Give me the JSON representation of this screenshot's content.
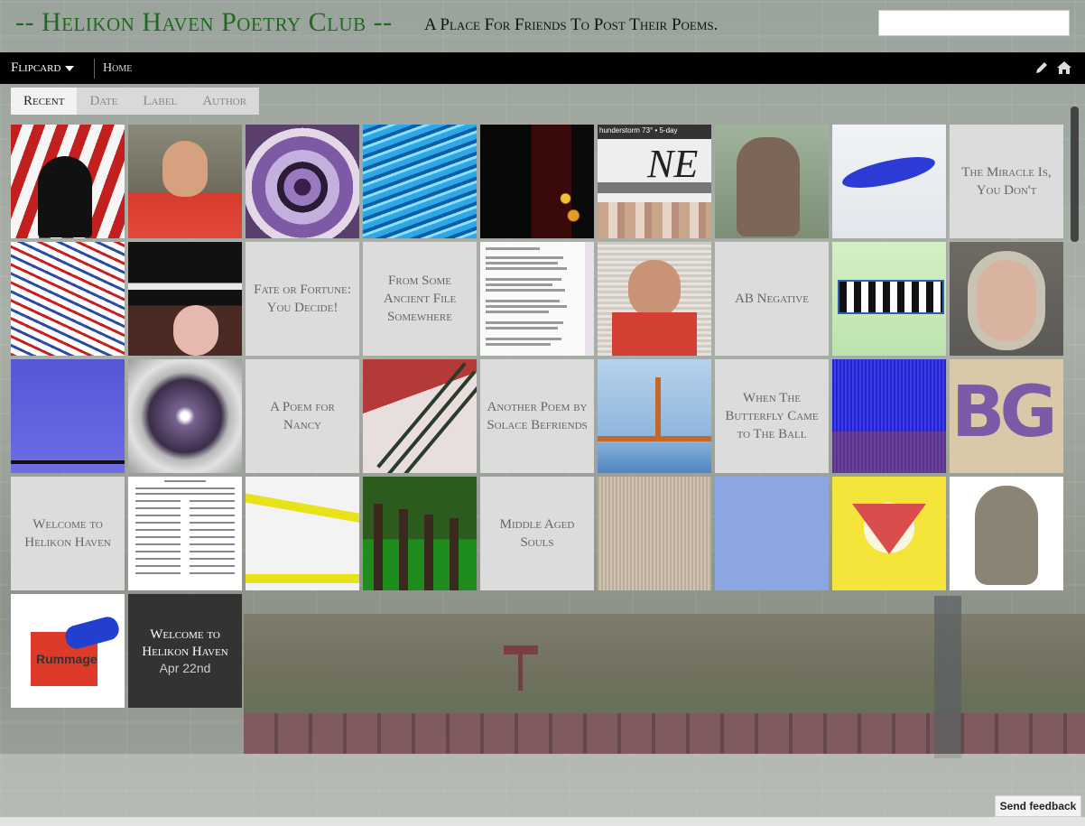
{
  "header": {
    "title": "-- Helikon Haven Poetry Club --",
    "description": "A Place For Friends To Post Their Poems."
  },
  "nav": {
    "view_label": "Flipcard",
    "home_label": "Home",
    "edit_icon": "pencil-icon",
    "home_icon": "home-icon"
  },
  "tabs": [
    {
      "label": "Recent",
      "active": true
    },
    {
      "label": "Date",
      "active": false
    },
    {
      "label": "Label",
      "active": false
    },
    {
      "label": "Author",
      "active": false
    }
  ],
  "cards": {
    "t1": "The Miracle Is, You Don't",
    "t2": "Fate or Fortune: You Decide!",
    "t3": "From Some Ancient File Somewhere",
    "t4": "AB Negative",
    "t5": "A Poem for Nancy",
    "t6": "Another Poem by Solace Befriends",
    "t7": "When The Butterfly Came to The Ball",
    "t8": "Welcome to Helikon Haven",
    "t9": "Middle Aged Souls",
    "featured_title": "Welcome to Helikon Haven",
    "featured_date": "Apr 22nd",
    "news_tile_text": "hunderstorm 73° • 5-day",
    "rummage_label": "Rummage"
  },
  "feedback_label": "Send feedback",
  "colors": {
    "title_green": "#1f6a1f",
    "navbar": "#000000",
    "tile_gray": "#dcdcdc",
    "tile_dark": "#333333"
  }
}
